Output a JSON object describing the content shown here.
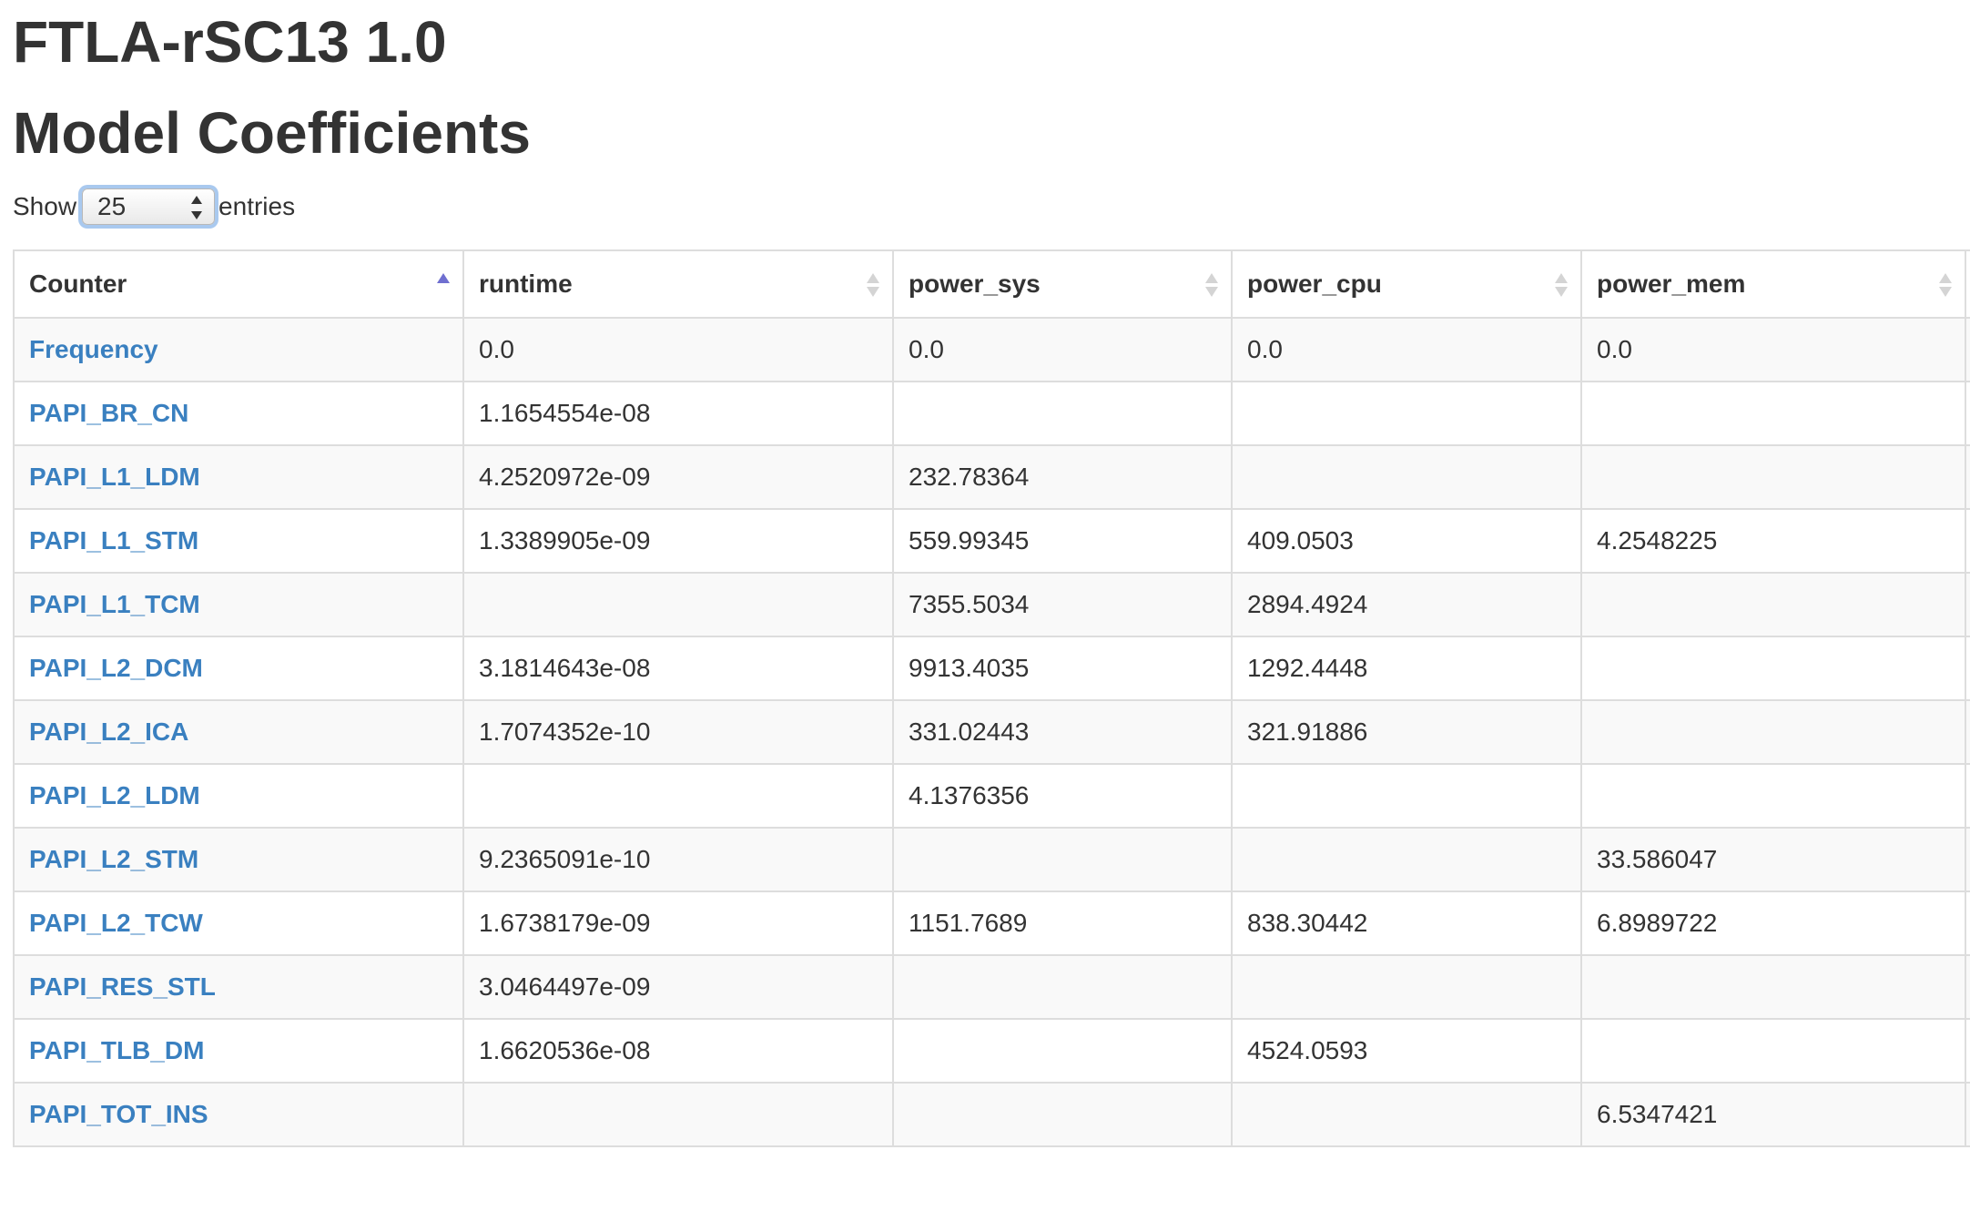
{
  "page": {
    "title": "FTLA-rSC13 1.0",
    "subtitle": "Model Coefficients"
  },
  "length_control": {
    "show_label": "Show",
    "selected": "25",
    "entries_label": "entries"
  },
  "table": {
    "columns": [
      {
        "label": "Counter",
        "sort": "ascending"
      },
      {
        "label": "runtime",
        "sort": "none"
      },
      {
        "label": "power_sys",
        "sort": "none"
      },
      {
        "label": "power_cpu",
        "sort": "none"
      },
      {
        "label": "power_mem",
        "sort": "none"
      }
    ],
    "rows": [
      [
        "Frequency",
        "0.0",
        "0.0",
        "0.0",
        "0.0"
      ],
      [
        "PAPI_BR_CN",
        "1.1654554e-08",
        "",
        "",
        ""
      ],
      [
        "PAPI_L1_LDM",
        "4.2520972e-09",
        "232.78364",
        "",
        ""
      ],
      [
        "PAPI_L1_STM",
        "1.3389905e-09",
        "559.99345",
        "409.0503",
        "4.2548225"
      ],
      [
        "PAPI_L1_TCM",
        "",
        "7355.5034",
        "2894.4924",
        ""
      ],
      [
        "PAPI_L2_DCM",
        "3.1814643e-08",
        "9913.4035",
        "1292.4448",
        ""
      ],
      [
        "PAPI_L2_ICA",
        "1.7074352e-10",
        "331.02443",
        "321.91886",
        ""
      ],
      [
        "PAPI_L2_LDM",
        "",
        "4.1376356",
        "",
        ""
      ],
      [
        "PAPI_L2_STM",
        "9.2365091e-10",
        "",
        "",
        "33.586047"
      ],
      [
        "PAPI_L2_TCW",
        "1.6738179e-09",
        "1151.7689",
        "838.30442",
        "6.8989722"
      ],
      [
        "PAPI_RES_STL",
        "3.0464497e-09",
        "",
        "",
        ""
      ],
      [
        "PAPI_TLB_DM",
        "1.6620536e-08",
        "",
        "4524.0593",
        ""
      ],
      [
        "PAPI_TOT_INS",
        "",
        "",
        "",
        "6.5347421"
      ]
    ]
  }
}
